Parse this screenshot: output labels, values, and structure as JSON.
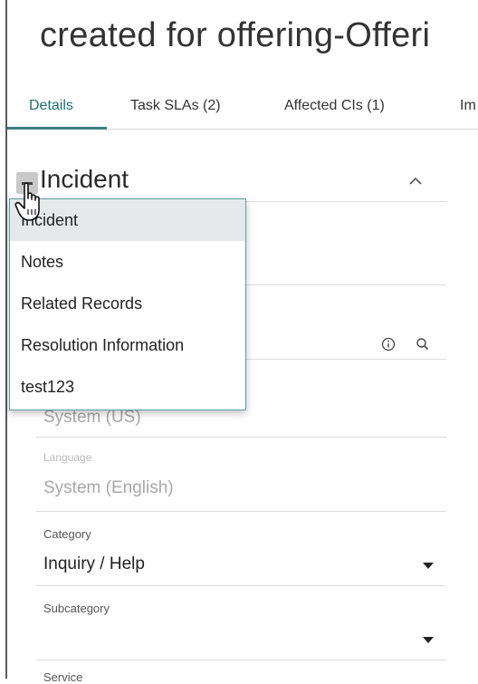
{
  "record": {
    "title": "created for offering-Offeri"
  },
  "tabs": [
    {
      "label": "Details",
      "active": true
    },
    {
      "label": "Task SLAs (2)",
      "active": false
    },
    {
      "label": "Affected CIs (1)",
      "active": false
    },
    {
      "label": "Im",
      "active": false
    }
  ],
  "section": {
    "title": "Incident",
    "collapse_icon": "chevron-up-icon",
    "toggle_icon": "minus-icon"
  },
  "menu": {
    "items": [
      {
        "label": "Incident",
        "highlighted": true
      },
      {
        "label": "Notes",
        "highlighted": false
      },
      {
        "label": "Related Records",
        "highlighted": false
      },
      {
        "label": "Resolution Information",
        "highlighted": false
      },
      {
        "label": "test123",
        "highlighted": false
      }
    ]
  },
  "reference_field": {
    "info_icon": "info-icon",
    "search_icon": "search-icon"
  },
  "fields": {
    "timezone": {
      "value": "System (US)",
      "disabled": true
    },
    "language": {
      "label": "Language",
      "value": "System (English)",
      "disabled": true
    },
    "category": {
      "label": "Category",
      "value": "Inquiry / Help"
    },
    "subcategory": {
      "label": "Subcategory",
      "value": ""
    },
    "next_label": "Service"
  },
  "colors": {
    "accent": "#3b7e82",
    "menu_border": "#5f9ea0",
    "highlight": "#e6e9ea"
  }
}
